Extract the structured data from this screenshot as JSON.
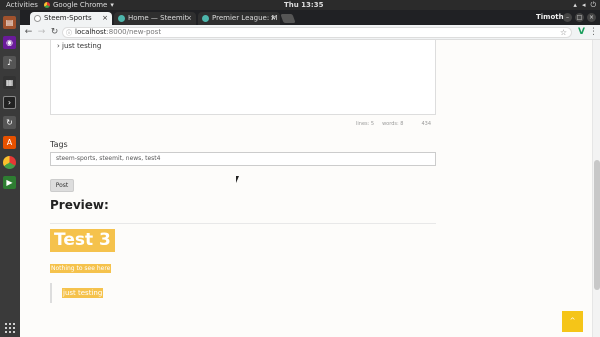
{
  "system": {
    "activities": "Activities",
    "app_name": "Google Chrome",
    "clock": "Thu 13:35"
  },
  "browser": {
    "tabs": [
      {
        "title": "Steem-Sports",
        "favicon_color": "#ffffff"
      },
      {
        "title": "Home — Steemit",
        "favicon_color": "#4db6ac"
      },
      {
        "title": "Premier League: M",
        "favicon_color": "#4db6ac"
      }
    ],
    "user": "Timothy",
    "url_host": "localhost",
    "url_rest": ":8000/new-post",
    "ext_icon": "V"
  },
  "editor": {
    "line": "› just testing"
  },
  "stats": {
    "lines": "lines: 5",
    "words": "words: 8",
    "count": "434"
  },
  "tags": {
    "label": "Tags",
    "value": "steem-sports, steemit, news, test4"
  },
  "post_button": "Post",
  "preview": {
    "heading": "Preview:",
    "h1": "Test 3",
    "subtitle": "Nothing to see here",
    "quote": "just testing"
  },
  "fab": {
    "icon": "^"
  },
  "colors": {
    "accent": "#f5c24c",
    "fab": "#f5c518"
  }
}
